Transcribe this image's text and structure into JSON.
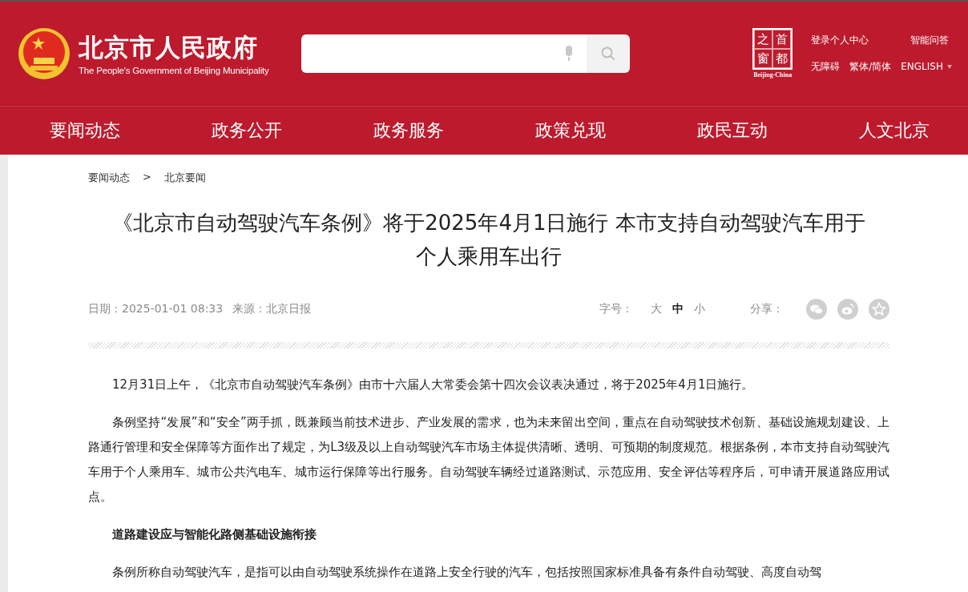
{
  "header": {
    "site_title": "北京市人民政府",
    "site_subtitle": "The People's Government of Beijing Municipality",
    "badge": {
      "chars": [
        "之",
        "首",
        "窗",
        "都"
      ],
      "caption": "Beijing-China"
    },
    "links_top": [
      "登录个人中心",
      "智能问答"
    ],
    "links_bottom": [
      {
        "label": "无障碍",
        "kind": "link"
      },
      {
        "label": "繁体/简体",
        "kind": "link"
      },
      {
        "label": "ENGLISH",
        "kind": "dropdown"
      }
    ]
  },
  "nav": [
    "要闻动态",
    "政务公开",
    "政务服务",
    "政策兑现",
    "政民互动",
    "人文北京"
  ],
  "breadcrumb": [
    "要闻动态",
    ">",
    "北京要闻"
  ],
  "article": {
    "title": "《北京市自动驾驶汽车条例》将于2025年4月1日施行 本市支持自动驾驶汽车用于个人乘用车出行",
    "date": "日期：2025-01-01 08:33",
    "source": "来源：北京日报",
    "font_size_label": "字号：",
    "font_sizes": [
      {
        "label": "大",
        "selected": false
      },
      {
        "label": "中",
        "selected": true
      },
      {
        "label": "小",
        "selected": false
      }
    ],
    "share_label": "分享：",
    "share_icons": [
      {
        "kind": "wechat"
      },
      {
        "kind": "weibo"
      },
      {
        "kind": "star"
      }
    ],
    "paragraphs": [
      {
        "kind": "text",
        "text": "12月31日上午，《北京市自动驾驶汽车条例》由市十六届人大常委会第十四次会议表决通过，将于2025年4月1日施行。"
      },
      {
        "kind": "text",
        "text": "条例坚持“发展”和“安全”两手抓，既兼顾当前技术进步、产业发展的需求，也为未来留出空间，重点在自动驾驶技术创新、基础设施规划建设、上路通行管理和安全保障等方面作出了规定，为L3级及以上自动驾驶汽车市场主体提供清晰、透明、可预期的制度规范。根据条例，本市支持自动驾驶汽车用于个人乘用车、城市公共汽电车、城市运行保障等出行服务。自动驾驶车辆经过道路测试、示范应用、安全评估等程序后，可申请开展道路应用试点。"
      },
      {
        "kind": "heading",
        "text": "道路建设应与智能化路侧基础设施衔接"
      },
      {
        "kind": "text",
        "text": "条例所称自动驾驶汽车，是指可以由自动驾驶系统操作在道路上安全行驶的汽车，包括按照国家标准具备有条件自动驾驶、高度自动驾"
      }
    ]
  }
}
